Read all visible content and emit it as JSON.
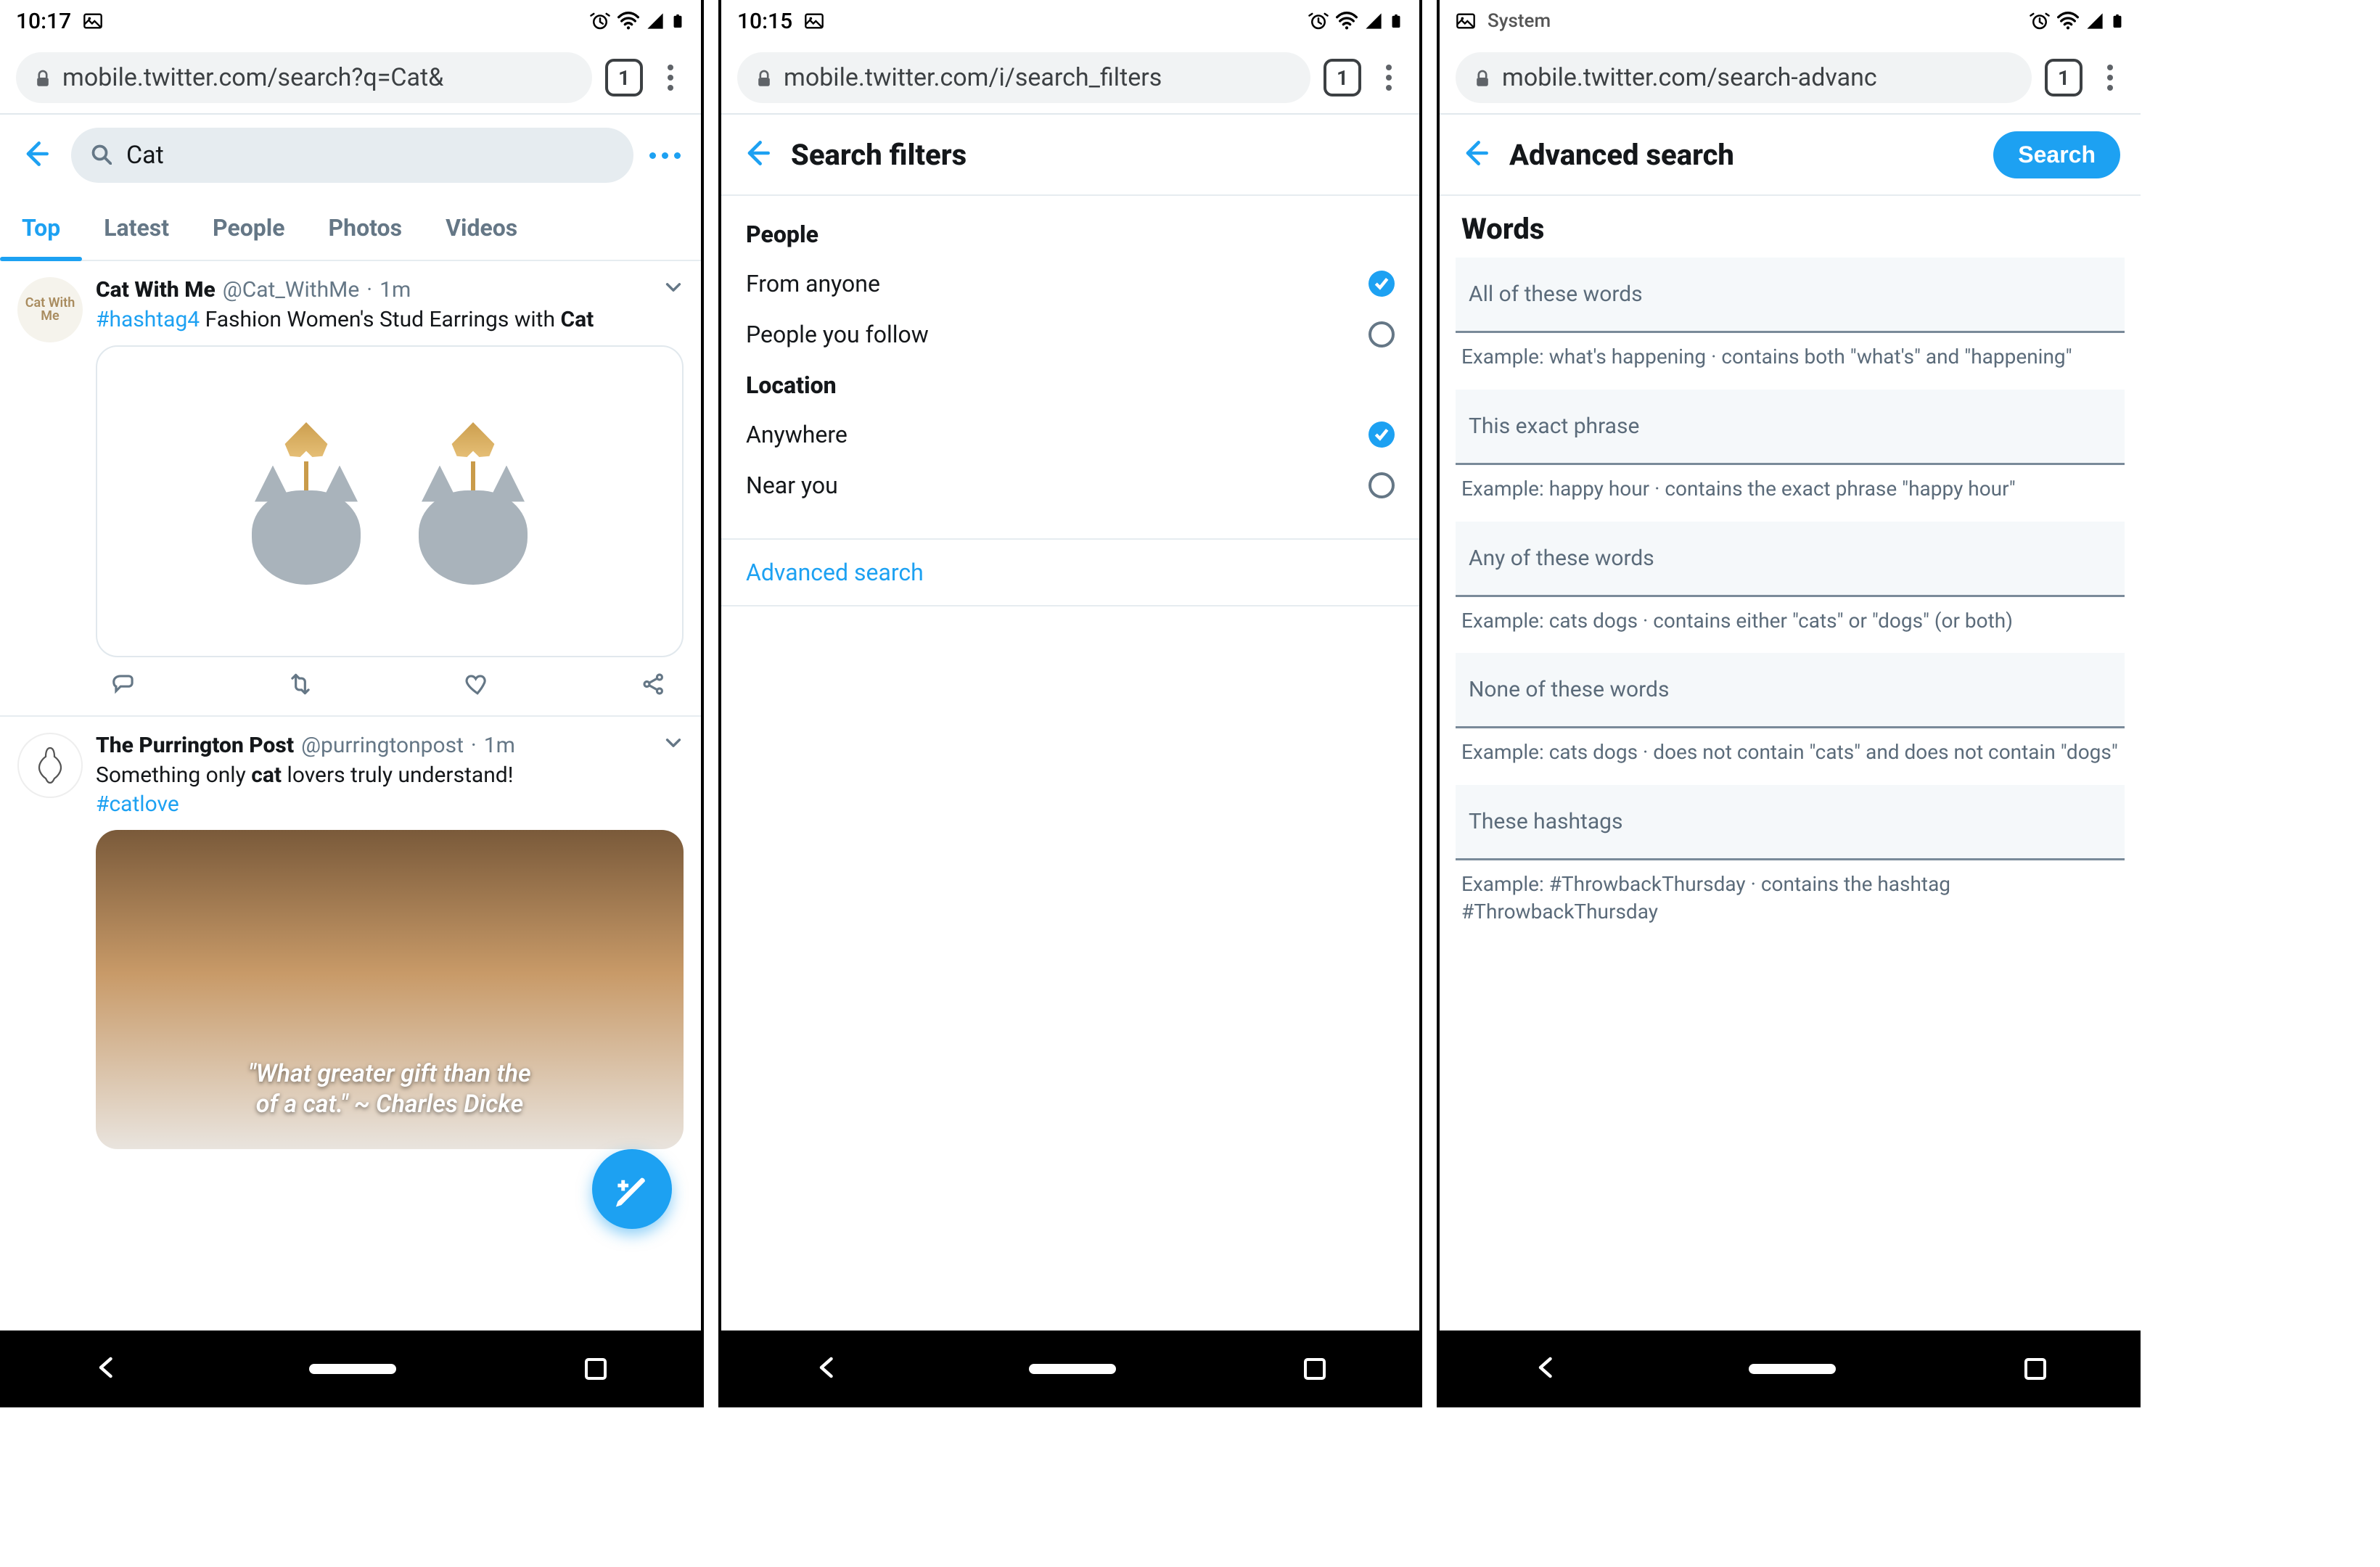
{
  "colors": {
    "accent": "#1da1f2",
    "muted": "#657786",
    "border": "#e6ecf0"
  },
  "screen1": {
    "status": {
      "time": "10:17",
      "label": ""
    },
    "chrome": {
      "url": "mobile.twitter.com/search?q=Cat&",
      "tab_count": "1"
    },
    "search": {
      "value": "Cat"
    },
    "tabs": [
      {
        "label": "Top",
        "active": true
      },
      {
        "label": "Latest",
        "active": false
      },
      {
        "label": "People",
        "active": false
      },
      {
        "label": "Photos",
        "active": false
      },
      {
        "label": "Videos",
        "active": false
      }
    ],
    "tweets": [
      {
        "avatar_text": "Cat With Me",
        "name": "Cat With Me",
        "handle": "@Cat_WithMe",
        "age": "1m",
        "hashtag": "#hashtag4",
        "text_after": " Fashion Women's Stud Earrings with ",
        "bold_tail": "Cat"
      },
      {
        "avatar_text": "",
        "name": "The Purrington Post",
        "handle": "@purringtonpost",
        "age": "1m",
        "line_pre": "Something only ",
        "line_bold": "cat",
        "line_post": " lovers truly understand!",
        "hashtag2": "#catlove",
        "quote_line1": "\"What greater gift than the",
        "quote_line2": "of a cat.\" ~ Charles Dicke"
      }
    ]
  },
  "screen2": {
    "status": {
      "time": "10:15",
      "label": ""
    },
    "chrome": {
      "url": "mobile.twitter.com/i/search_filters",
      "tab_count": "1"
    },
    "title": "Search filters",
    "groups": [
      {
        "title": "People",
        "options": [
          {
            "label": "From anyone",
            "checked": true
          },
          {
            "label": "People you follow",
            "checked": false
          }
        ]
      },
      {
        "title": "Location",
        "options": [
          {
            "label": "Anywhere",
            "checked": true
          },
          {
            "label": "Near you",
            "checked": false
          }
        ]
      }
    ],
    "advanced_link": "Advanced search"
  },
  "screen3": {
    "status": {
      "time": "",
      "label": "System"
    },
    "chrome": {
      "url": "mobile.twitter.com/search-advanc",
      "tab_count": "1"
    },
    "title": "Advanced search",
    "search_button": "Search",
    "section": "Words",
    "fields": [
      {
        "label": "All of these words",
        "example": "Example: what's happening · contains both \"what's\" and \"happening\""
      },
      {
        "label": "This exact phrase",
        "example": "Example: happy hour · contains the exact phrase \"happy hour\""
      },
      {
        "label": "Any of these words",
        "example": "Example: cats dogs · contains either \"cats\" or \"dogs\" (or both)"
      },
      {
        "label": "None of these words",
        "example": "Example: cats dogs · does not contain \"cats\" and does not contain \"dogs\""
      },
      {
        "label": "These hashtags",
        "example": "Example: #ThrowbackThursday · contains the hashtag #ThrowbackThursday"
      }
    ]
  }
}
